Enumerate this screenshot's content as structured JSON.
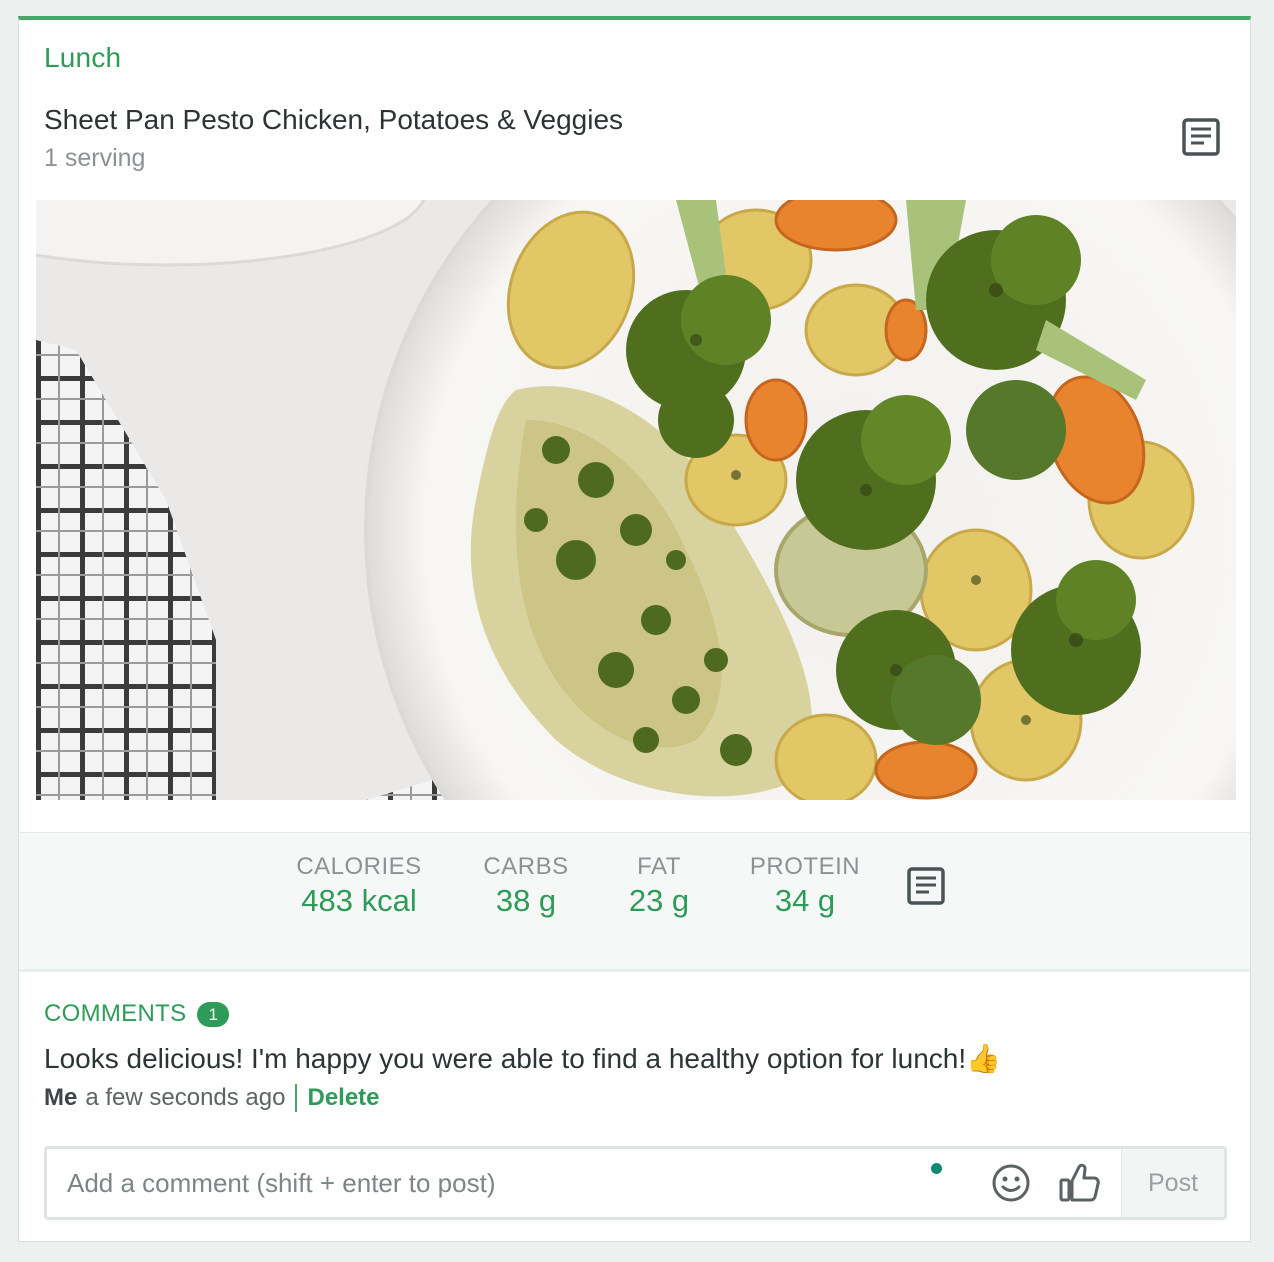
{
  "meal": {
    "type": "Lunch",
    "title": "Sheet Pan Pesto Chicken, Potatoes & Veggies",
    "serving": "1 serving"
  },
  "icons": {
    "recipe_details": "document-lines-icon",
    "nutrition_details": "document-lines-icon",
    "emoji": "smiley-face-icon",
    "like": "thumbs-up-icon",
    "status_dot": "online-dot-icon"
  },
  "nutrition": [
    {
      "label": "CALORIES",
      "value": "483 kcal"
    },
    {
      "label": "CARBS",
      "value": "38 g"
    },
    {
      "label": "FAT",
      "value": "23 g"
    },
    {
      "label": "PROTEIN",
      "value": "34 g"
    }
  ],
  "comments": {
    "header": "COMMENTS",
    "count": "1",
    "items": [
      {
        "text": "Looks delicious! I'm happy you were able to find a healthy option for lunch!👍",
        "author": "Me",
        "time": "a few seconds ago",
        "delete_label": "Delete"
      }
    ]
  },
  "composer": {
    "placeholder": "Add a comment (shift + enter to post)",
    "value": "",
    "post_label": "Post"
  },
  "colors": {
    "accent": "#2f9b58",
    "top_border": "#4aa569",
    "text": "#2c3436",
    "muted": "#8c9294",
    "status_dot": "#0f8a72"
  }
}
